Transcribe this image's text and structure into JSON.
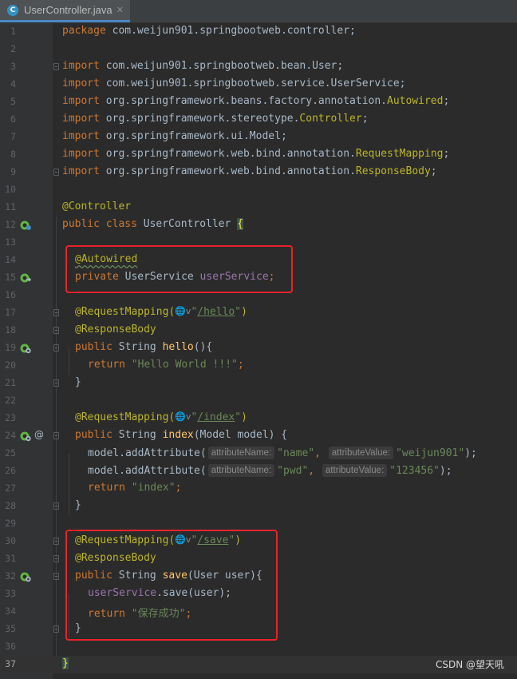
{
  "tab": {
    "file_name": "UserController.java",
    "close_glyph": "✕",
    "file_icon": "class-c-icon"
  },
  "lines": {
    "l1": {
      "num": "1",
      "pkg_kw": "package",
      "pkg": " com.weijun901.springbootweb.controller;"
    },
    "l2": {
      "num": "2"
    },
    "l3": {
      "num": "3",
      "kw": "import",
      "rest": " com.weijun901.springbootweb.bean.User;"
    },
    "l4": {
      "num": "4",
      "kw": "import",
      "rest": " com.weijun901.springbootweb.service.UserService;"
    },
    "l5": {
      "num": "5",
      "kw": "import",
      "rest": " org.springframework.beans.factory.annotation.",
      "cls": "Autowired",
      "end": ";"
    },
    "l6": {
      "num": "6",
      "kw": "import",
      "rest": " org.springframework.stereotype.",
      "cls": "Controller",
      "end": ";"
    },
    "l7": {
      "num": "7",
      "kw": "import",
      "rest": " org.springframework.ui.Model;"
    },
    "l8": {
      "num": "8",
      "kw": "import",
      "rest": " org.springframework.web.bind.annotation.",
      "cls": "RequestMapping",
      "end": ";"
    },
    "l9": {
      "num": "9",
      "kw": "import",
      "rest": " org.springframework.web.bind.annotation.",
      "cls": "ResponseBody",
      "end": ";"
    },
    "l10": {
      "num": "10"
    },
    "l11": {
      "num": "11",
      "an": "@Controller"
    },
    "l12": {
      "num": "12",
      "kw": "public class",
      "name": " UserController ",
      "brace": "{"
    },
    "l13": {
      "num": "13"
    },
    "l14": {
      "num": "14",
      "an": "@Autowired"
    },
    "l15": {
      "num": "15",
      "kw": "private",
      "type": " UserService ",
      "field": "userService",
      "end": ";"
    },
    "l16": {
      "num": "16"
    },
    "l17": {
      "num": "17",
      "an": "@RequestMapping(",
      "globe": "🌐v",
      "q1": "\"",
      "path": "/hello",
      "q2": "\"",
      "close": ")"
    },
    "l18": {
      "num": "18",
      "an": "@ResponseBody"
    },
    "l19": {
      "num": "19",
      "kw": "public",
      "type": " String ",
      "fn": "hello",
      "rest": "(){"
    },
    "l20": {
      "num": "20",
      "kw": "return ",
      "str": "\"Hello World !!!\"",
      "end": ";"
    },
    "l21": {
      "num": "21",
      "text": "}"
    },
    "l22": {
      "num": "22"
    },
    "l23": {
      "num": "23",
      "an": "@RequestMapping(",
      "globe": "🌐v",
      "q1": "\"",
      "path": "/index",
      "q2": "\"",
      "close": ")"
    },
    "l24": {
      "num": "24",
      "kw": "public",
      "type": " String ",
      "fn": "index",
      "rest": "(Model model) {"
    },
    "l25": {
      "num": "25",
      "pre": "model.addAttribute(",
      "hint1": "attributeName:",
      "str1": "\"name\"",
      "comma": ", ",
      "hint2": "attributeValue:",
      "str2": "\"weijun901\"",
      "end": ");"
    },
    "l26": {
      "num": "26",
      "pre": "model.addAttribute(",
      "hint1": "attributeName:",
      "str1": "\"pwd\"",
      "comma": ", ",
      "hint2": "attributeValue:",
      "str2": "\"123456\"",
      "end": ");"
    },
    "l27": {
      "num": "27",
      "kw": "return ",
      "str": "\"index\"",
      "end": ";"
    },
    "l28": {
      "num": "28",
      "text": "}"
    },
    "l29": {
      "num": "29"
    },
    "l30": {
      "num": "30",
      "an": "@RequestMapping(",
      "globe": "🌐v",
      "q1": "\"",
      "path": "/save",
      "q2": "\"",
      "close": ")"
    },
    "l31": {
      "num": "31",
      "an": "@ResponseBody"
    },
    "l32": {
      "num": "32",
      "kw": "public",
      "type": " String ",
      "fn": "save",
      "rest": "(User user){"
    },
    "l33": {
      "num": "33",
      "field": "userService",
      "rest": ".save(user);"
    },
    "l34": {
      "num": "34",
      "kw": "return ",
      "str": "\"保存成功\"",
      "end": ";"
    },
    "l35": {
      "num": "35",
      "text": "}"
    },
    "l36": {
      "num": "36"
    },
    "l37": {
      "num": "37",
      "brace": "}"
    }
  },
  "gutter_icons": {
    "bean": "spring-bean-icon",
    "autowired": "autowired-navigate-icon",
    "web": "web-endpoint-icon",
    "at": "@"
  },
  "watermark": "CSDN @望天吼",
  "colors": {
    "background": "#2b2b2b",
    "keyword": "#cc7832",
    "annotation": "#bbb529",
    "string": "#6a8759",
    "field": "#9876aa",
    "method": "#ffc66d",
    "highlight_box": "#e8232b"
  }
}
